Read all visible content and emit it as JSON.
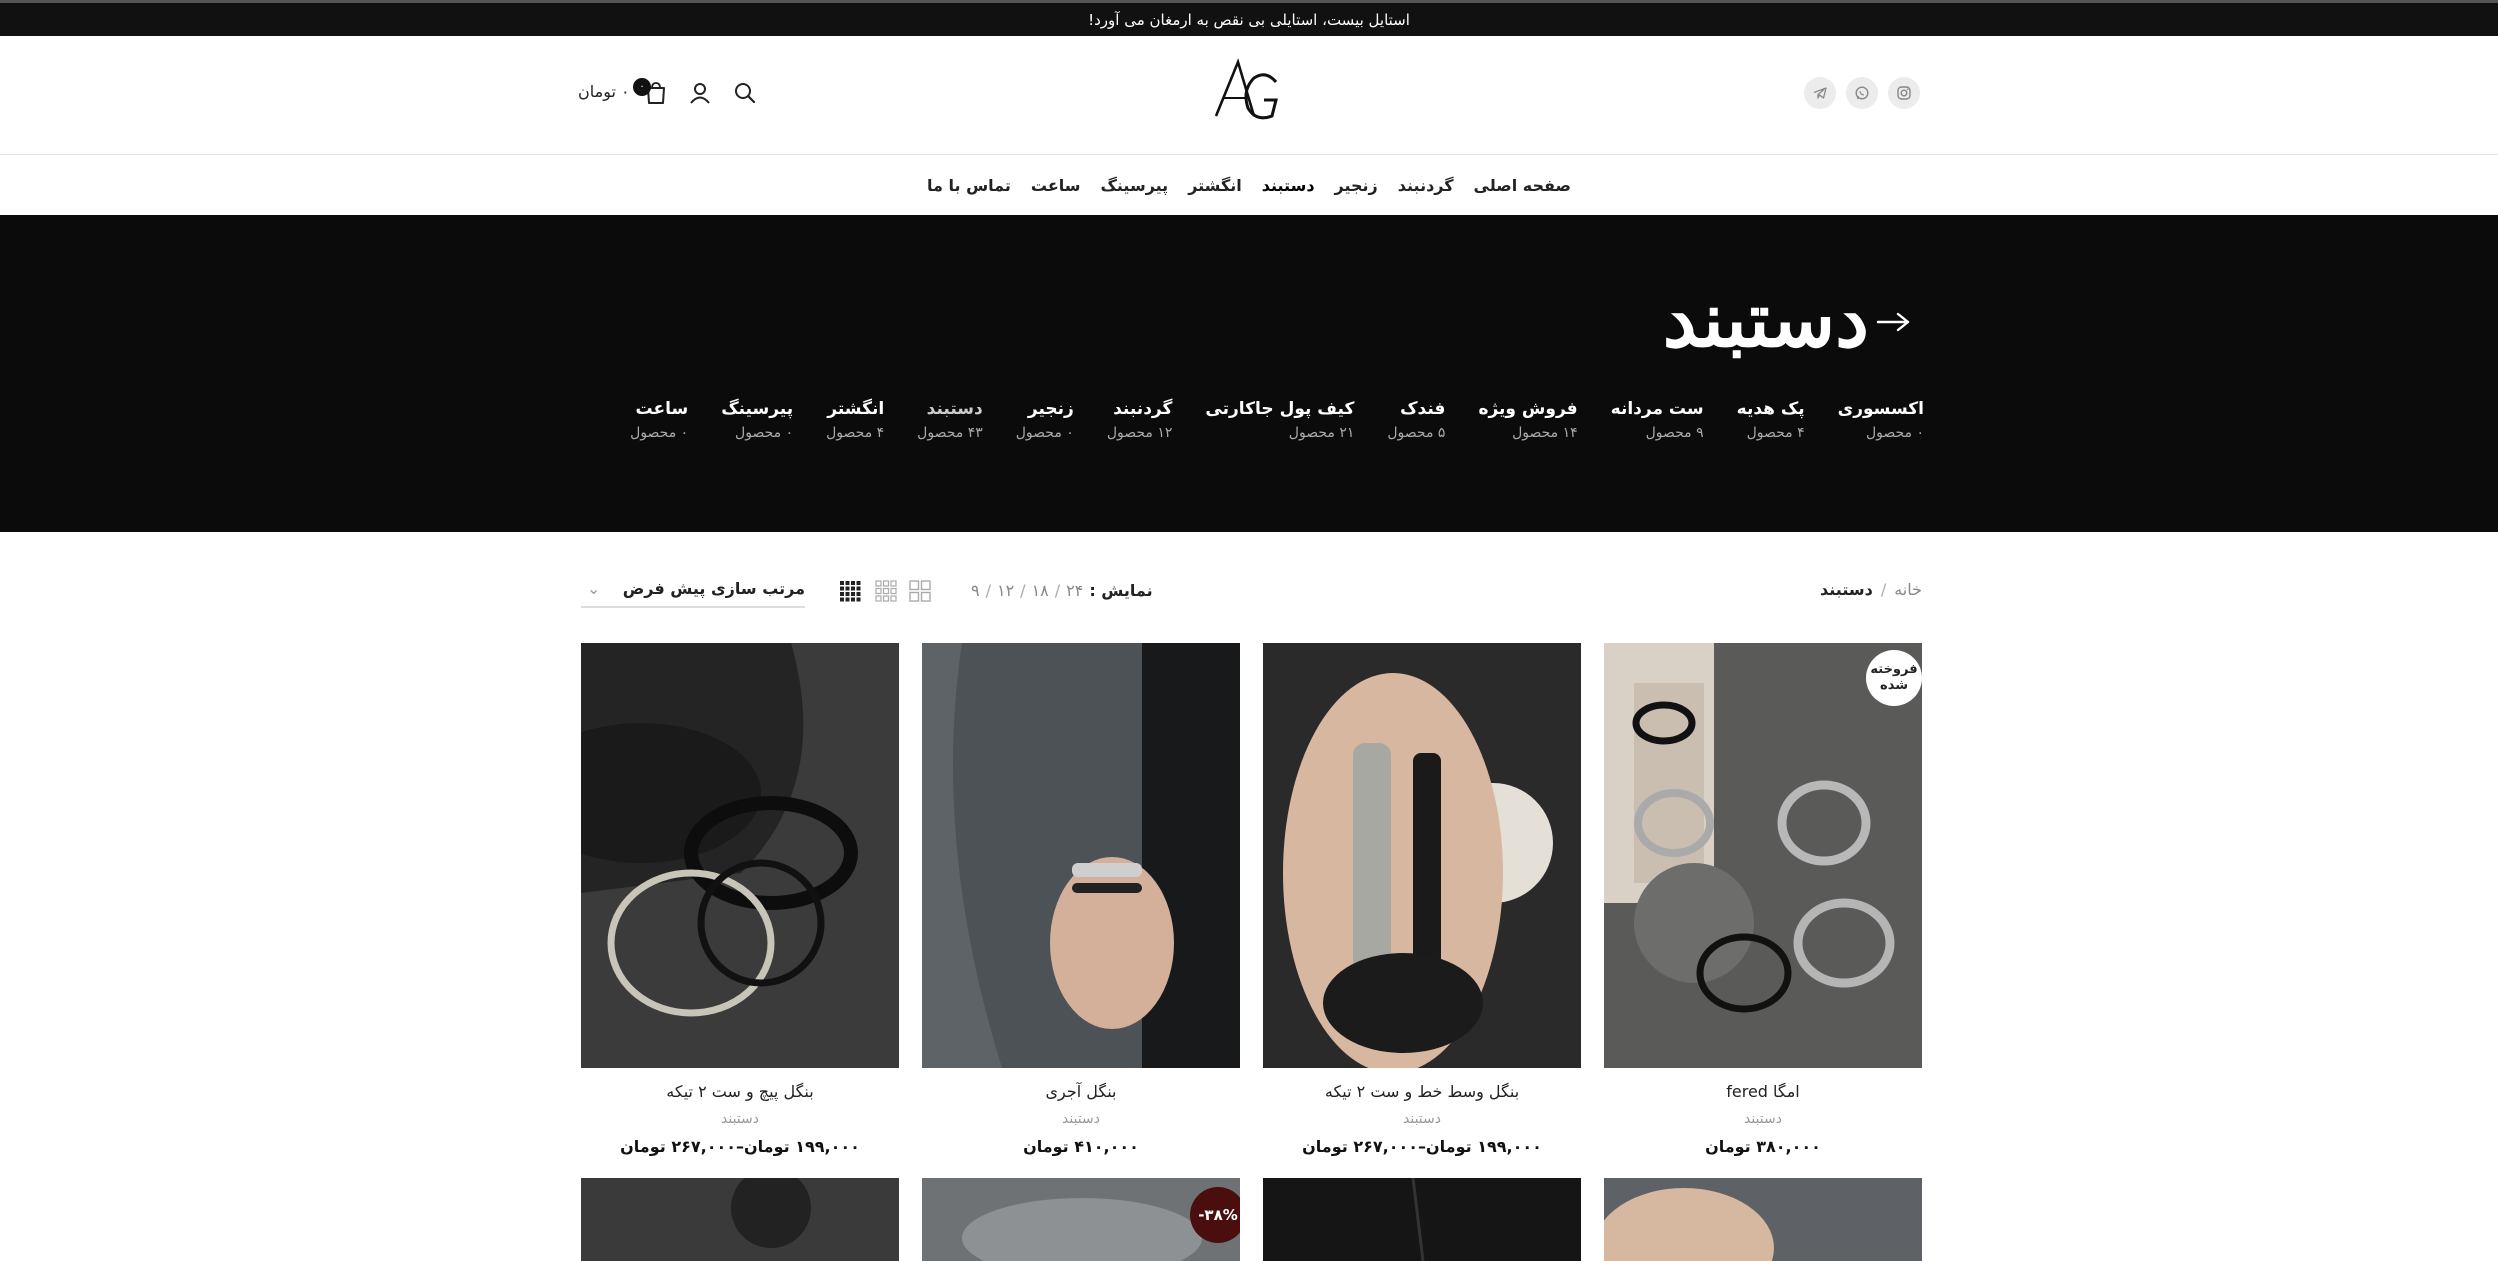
{
  "topbar": {
    "text": "استایل بیست، استایلی بی نقص به ارمغان می آورد!"
  },
  "header": {
    "social": [
      {
        "icon": "instagram-icon"
      },
      {
        "icon": "whatsapp-icon"
      },
      {
        "icon": "telegram-icon"
      }
    ],
    "logo_text": "AG",
    "cart_count": "۰",
    "cart_total": "۰ تومان"
  },
  "nav": {
    "items": [
      {
        "label": "صفحه اصلی"
      },
      {
        "label": "گردنبند"
      },
      {
        "label": "زنجیر"
      },
      {
        "label": "دستبند"
      },
      {
        "label": "انگشتر"
      },
      {
        "label": "پیرسینگ"
      },
      {
        "label": "ساعت"
      },
      {
        "label": "تماس با ما"
      }
    ]
  },
  "hero": {
    "title": "دستبند",
    "categories": [
      {
        "name": "اکسسوری",
        "count": "۰ محصول"
      },
      {
        "name": "پک هدیه",
        "count": "۴ محصول"
      },
      {
        "name": "ست مردانه",
        "count": "۹ محصول"
      },
      {
        "name": "فروش ویژه",
        "count": "۱۴ محصول"
      },
      {
        "name": "فندک",
        "count": "۵ محصول"
      },
      {
        "name": "کیف پول جاکارتی",
        "count": "۲۱ محصول"
      },
      {
        "name": "گردنبند",
        "count": "۱۲ محصول"
      },
      {
        "name": "زنجیر",
        "count": "۰ محصول"
      },
      {
        "name": "دستبند",
        "count": "۴۳ محصول"
      },
      {
        "name": "انگشتر",
        "count": "۴ محصول"
      },
      {
        "name": "پیرسینگ",
        "count": "۰ محصول"
      },
      {
        "name": "ساعت",
        "count": "۰ محصول"
      }
    ]
  },
  "toolbar": {
    "breadcrumb_home": "خانه",
    "breadcrumb_sep": "/",
    "breadcrumb_current": "دستبند",
    "perpage_label": "نمایش :",
    "perpage_options": [
      "۹",
      "۱۲",
      "۱۸",
      "۲۴"
    ],
    "perpage_sep": "/",
    "sort_label": "مرتب سازی پیش فرض",
    "sort_chevron": "⌄"
  },
  "products": [
    {
      "title": "امگا fered",
      "category": "دستبند",
      "price": "۳۸۰,۰۰۰ تومان",
      "badge": "فروخته شده"
    },
    {
      "title": "بنگل وسط خط و ست ۲ تیکه",
      "category": "دستبند",
      "price": "۱۹۹,۰۰۰ تومان–۲۶۷,۰۰۰ تومان"
    },
    {
      "title": "بنگل آجری",
      "category": "دستبند",
      "price": "۴۱۰,۰۰۰ تومان"
    },
    {
      "title": "بنگل پیچ و ست ۲ تیکه",
      "category": "دستبند",
      "price": "۱۹۹,۰۰۰ تومان–۲۶۷,۰۰۰ تومان"
    }
  ],
  "row2": {
    "discount_badge": "-۳۸%"
  },
  "colors": {
    "dark": "#0b0b0b",
    "accent": "#4a0e0e"
  }
}
